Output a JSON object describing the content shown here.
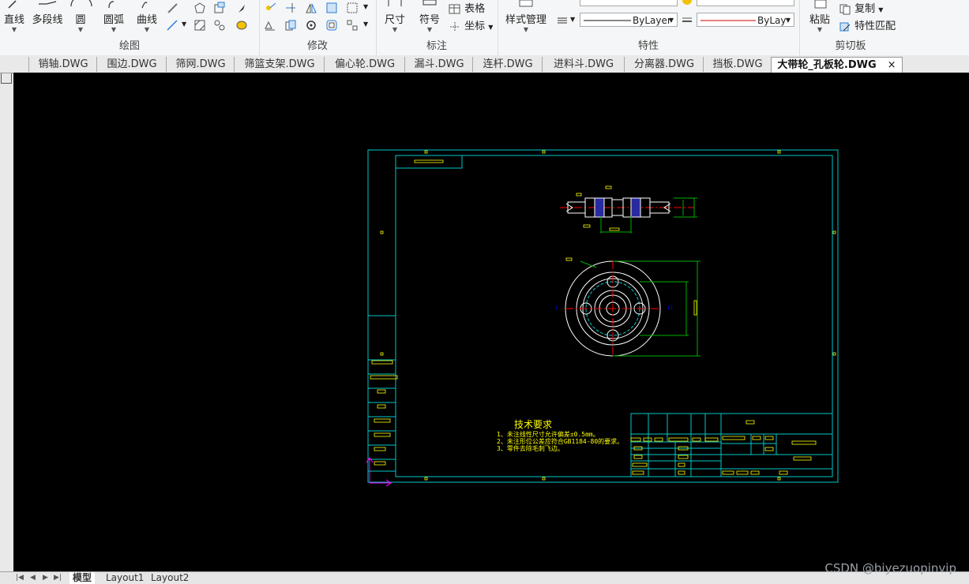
{
  "ribbon": {
    "draw": {
      "group_label": "绘图",
      "line": "直线",
      "polyline": "多段线",
      "circle": "圆",
      "arc": "圆弧",
      "curve": "曲线"
    },
    "modify": {
      "group_label": "修改"
    },
    "annotate": {
      "group_label": "标注",
      "dimension": "尺寸",
      "symbol": "符号",
      "table": "表格",
      "coordinate": "坐标"
    },
    "properties": {
      "group_label": "特性",
      "style_manager": "样式管理",
      "linetype_value": "ByLayer",
      "lineweight_value": "ByLay"
    },
    "clipboard": {
      "group_label": "剪切板",
      "paste": "粘贴",
      "copy": "复制",
      "match_properties": "特性匹配"
    }
  },
  "tabs": [
    {
      "label": "销轴.DWG"
    },
    {
      "label": "围边.DWG"
    },
    {
      "label": "筛网.DWG"
    },
    {
      "label": "筛篮支架.DWG"
    },
    {
      "label": "偏心轮.DWG"
    },
    {
      "label": "漏斗.DWG"
    },
    {
      "label": "连杆.DWG"
    },
    {
      "label": "进料斗.DWG"
    },
    {
      "label": "分离器.DWG"
    },
    {
      "label": "挡板.DWG"
    },
    {
      "label": "大带轮_孔板轮.DWG",
      "active": true
    }
  ],
  "drawing": {
    "tech_title": "技术要求",
    "tech_notes": [
      "1、未注线性尺寸允许偏差±0.5mm。",
      "2、未注形位公差应符合GB1184-80的要求。",
      "3、零件去除毛刺飞边。"
    ]
  },
  "layouts": [
    {
      "label": "模型",
      "active": true
    },
    {
      "label": "Layout1"
    },
    {
      "label": "Layout2"
    }
  ],
  "watermark": "CSDN @biyezuopinvip",
  "colors": {
    "canvas_bg": "#000000",
    "frame": "#00c8c8",
    "text": "#ffff00",
    "dimension": "#00b000",
    "centerline": "#ff0000",
    "hidden": "#0000ff",
    "ucs": "#ff00ff"
  }
}
